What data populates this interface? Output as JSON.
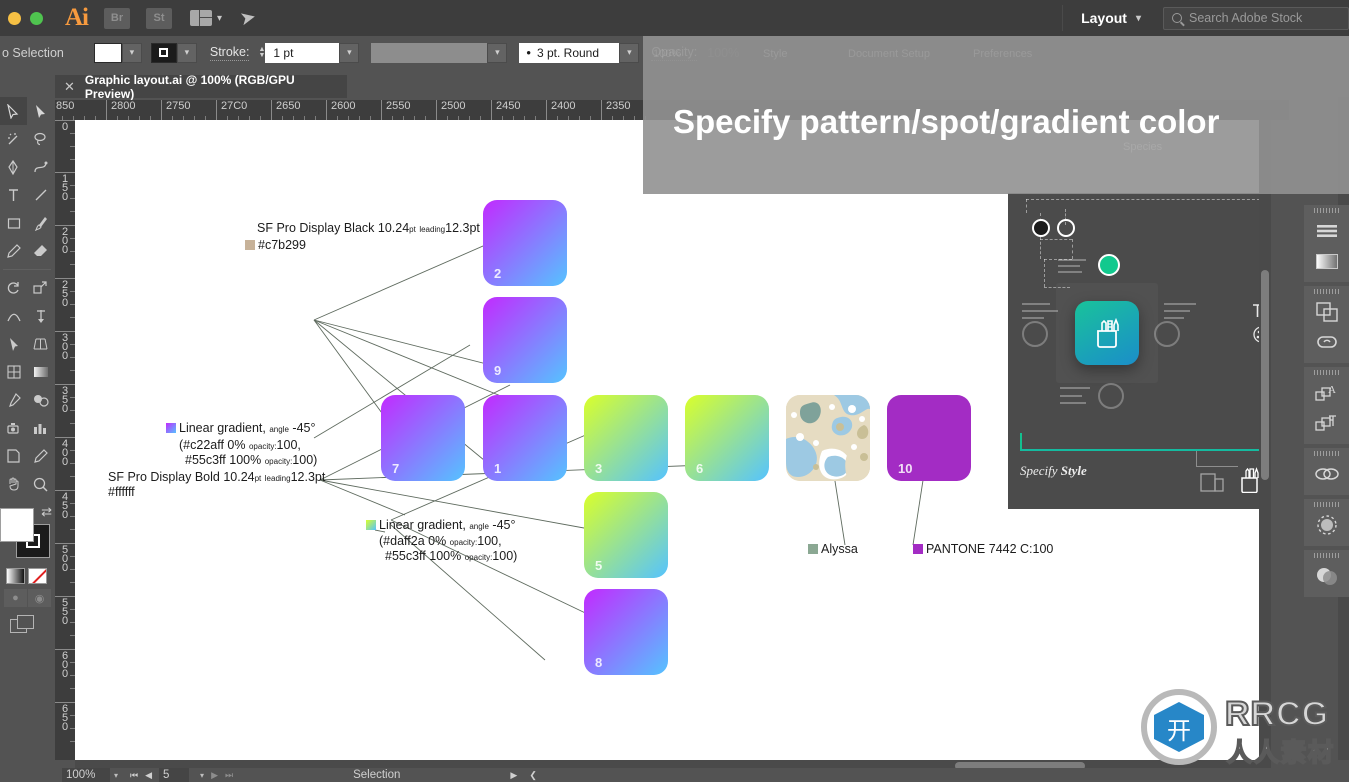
{
  "titlebar": {
    "app_logo": "Ai",
    "bridge_label": "Br",
    "stock_label": "St",
    "arrange_icon": "arrange-documents-icon",
    "rocket_icon": "rocket-icon",
    "layout_label": "Layout",
    "search_placeholder": "Search Adobe Stock"
  },
  "controlbar": {
    "selection_status": "o Selection",
    "stroke_label": "Stroke:",
    "stroke_weight": "1 pt",
    "brush_profile": "3 pt. Round",
    "opacity_label": "Opacity:",
    "opacity_value": "100%"
  },
  "tabs": {
    "close_icon": "close-icon",
    "document_title": "Graphic layout.ai @ 100% (RGB/GPU Preview)"
  },
  "rulers": {
    "horizontal": [
      "850",
      "2800",
      "2750",
      "27C0",
      "2650",
      "2600",
      "2550",
      "2500",
      "2450",
      "2400",
      "2350"
    ],
    "vertical": [
      "0",
      "150",
      "200",
      "250",
      "300",
      "350",
      "400",
      "450",
      "500",
      "550",
      "600",
      "650"
    ]
  },
  "overlay": {
    "title": "Specify pattern/spot/gradient color",
    "ghost_items": [
      "100%",
      "Style",
      "Document Setup",
      "Preferences",
      "Species"
    ]
  },
  "artwork": {
    "cards": [
      {
        "num": "2",
        "kind": "gradient-purple"
      },
      {
        "num": "9",
        "kind": "gradient-purple"
      },
      {
        "num": "7",
        "kind": "gradient-purple"
      },
      {
        "num": "1",
        "kind": "gradient-purple"
      },
      {
        "num": "3",
        "kind": "gradient-green"
      },
      {
        "num": "6",
        "kind": "gradient-green"
      },
      {
        "num": "5",
        "kind": "gradient-green"
      },
      {
        "num": "8",
        "kind": "gradient-purple"
      },
      {
        "num": "",
        "kind": "pattern-blob"
      },
      {
        "num": "10",
        "kind": "solid-purple"
      }
    ],
    "annotations": {
      "black_font": {
        "font_line": "SF Pro Display Black 10.24",
        "unit": "pt",
        "leading_label": "leading",
        "leading_value": "12.3pt",
        "color_hex": "#c7b299",
        "chip_color": "#c7b299"
      },
      "purple_gradient": {
        "title": "Linear gradient,",
        "angle_label": "angle",
        "angle_value": "-45°",
        "stop1": "(#c22aff  0%",
        "stop1_opacity_label": "opacity:",
        "stop1_opacity": "100,",
        "stop2": "#55c3ff  100%",
        "stop2_opacity_label": "opacity:",
        "stop2_opacity": "100)"
      },
      "bold_font": {
        "font_line": "SF Pro Display Bold 10.24",
        "unit": "pt",
        "leading_label": "leading",
        "leading_value": "12.3pt",
        "color_hex": "#ffffff"
      },
      "green_gradient": {
        "title": "Linear gradient,",
        "angle_label": "angle",
        "angle_value": "-45°",
        "stop1": "(#daff2a  0%",
        "stop1_opacity_label": "opacity:",
        "stop1_opacity": "100,",
        "stop2": "#55c3ff  100%",
        "stop2_opacity_label": "opacity:",
        "stop2_opacity": "100)"
      },
      "pattern": {
        "label": "Alyssa",
        "chip_color": "#8ba893"
      },
      "spot": {
        "label": "PANTONE 7442 C:100",
        "chip_color": "#a32cc4"
      }
    }
  },
  "style_panel": {
    "caption_prefix": "Specify ",
    "caption_bold": "Style",
    "app_icon": "pencil-cup-icon",
    "text_icon": "text-style-icon",
    "palette_icon": "color-palette-icon",
    "accent_color": "#13c08f"
  },
  "dock": {
    "icons": [
      "libraries-icon",
      "gradient-icon",
      "layers-icon",
      "creative-cloud-icon",
      "character-styles-icon",
      "paragraph-styles-icon",
      "links-icon",
      "appearance-icon",
      "transparency-icon"
    ]
  },
  "statusbar": {
    "zoom": "100%",
    "first_icon": "first-page-icon",
    "prev_icon": "prev-page-icon",
    "page": "5",
    "next_icon": "next-page-icon",
    "last_icon": "last-page-icon",
    "tool_status": "Selection"
  },
  "watermark": {
    "brand": "RRCG",
    "brand_cn": "人人素材"
  }
}
